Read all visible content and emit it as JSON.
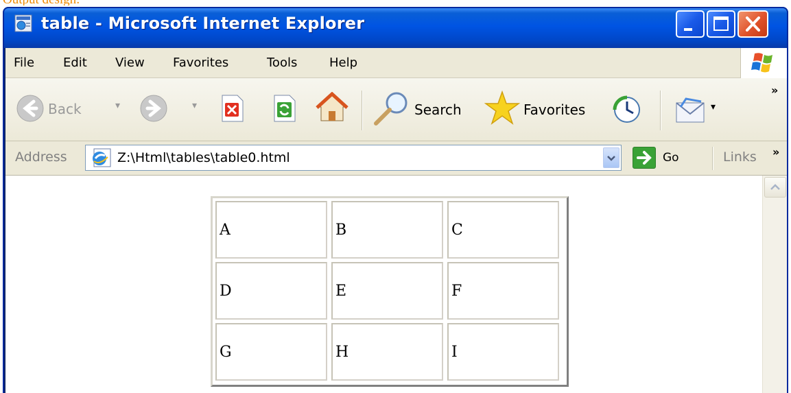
{
  "caption": "Output design:",
  "window": {
    "title": "table - Microsoft Internet Explorer"
  },
  "menu": [
    "File",
    "Edit",
    "View",
    "Favorites",
    "Tools",
    "Help"
  ],
  "toolbar": {
    "back_label": "Back",
    "search_label": "Search",
    "favorites_label": "Favorites",
    "overflow": "»"
  },
  "address": {
    "label": "Address",
    "url": "Z:\\Html\\tables\\table0.html",
    "go_label": "Go",
    "links_label": "Links",
    "links_overflow": "»"
  },
  "table": {
    "rows": [
      [
        "A",
        "B",
        "C"
      ],
      [
        "D",
        "E",
        "F"
      ],
      [
        "G",
        "H",
        "I"
      ]
    ]
  }
}
